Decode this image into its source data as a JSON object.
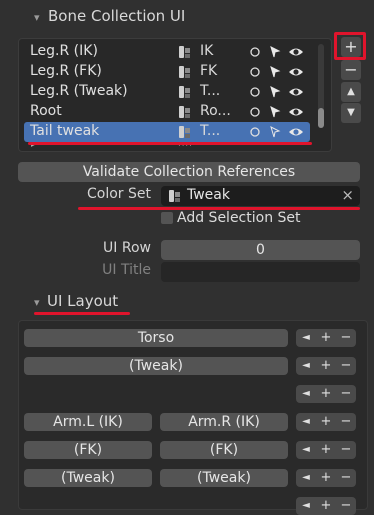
{
  "panel": {
    "title": "Bone Collection UI",
    "layout_title": "UI Layout"
  },
  "collections": [
    {
      "name": "Leg.R (IK)",
      "group": "IK",
      "selected": false
    },
    {
      "name": "Leg.R (FK)",
      "group": "FK",
      "selected": false
    },
    {
      "name": "Leg.R (Tweak)",
      "group": "T...",
      "selected": false
    },
    {
      "name": "Root",
      "group": "Ro...",
      "selected": false
    },
    {
      "name": "Tail tweak",
      "group": "T...",
      "selected": true
    }
  ],
  "side_buttons": {
    "add": "+",
    "remove": "−",
    "up": "▲",
    "down": "▼"
  },
  "list_footer": {
    "grip": "::::",
    "expand": "▸"
  },
  "validate_button": "Validate Collection References",
  "color_set": {
    "label": "Color Set",
    "value": "Tweak",
    "clear": "×"
  },
  "add_selection_set": "Add Selection Set",
  "ui_row": {
    "label": "UI Row",
    "value": "0"
  },
  "ui_title": {
    "label": "UI Title",
    "value": ""
  },
  "layout_rows": [
    {
      "buttons": [
        "Torso"
      ]
    },
    {
      "buttons": [
        "(Tweak)"
      ]
    },
    {
      "buttons": []
    },
    {
      "buttons": [
        "Arm.L (IK)",
        "Arm.R (IK)"
      ]
    },
    {
      "buttons": [
        "(FK)",
        "(FK)"
      ]
    },
    {
      "buttons": [
        "(Tweak)",
        "(Tweak)"
      ]
    },
    {
      "buttons": []
    }
  ],
  "row_controls": {
    "left": "◄",
    "add": "+",
    "remove": "−"
  },
  "colors": {
    "accent": "#4772b3",
    "highlight": "#e0142c",
    "background": "#303030"
  }
}
